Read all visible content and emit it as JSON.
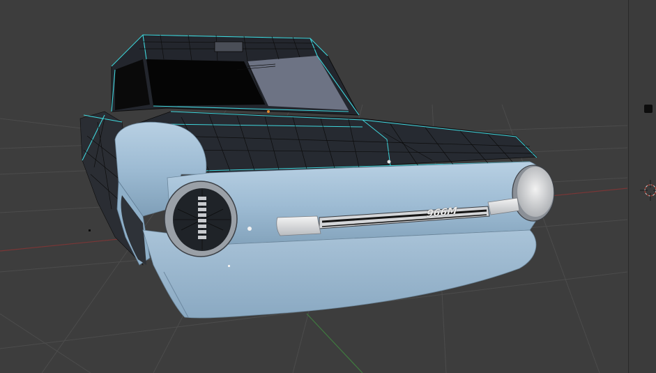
{
  "viewport": {
    "background": "#3d3d3d",
    "grid_color": "#4a4a4a",
    "x_axis_color": "#8a3a3a",
    "y_axis_color": "#3d7a3d"
  },
  "model": {
    "body_color": "#9dbbd3",
    "wire_color_selected": "#4fe0e6",
    "wire_color": "#0a0a0a",
    "headlight_color": "#cfd2d6",
    "badge_text": "966M"
  },
  "side_panel": {
    "background": "#3b3b3b"
  }
}
